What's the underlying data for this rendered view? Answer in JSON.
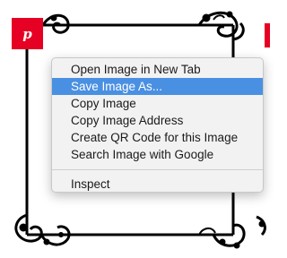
{
  "colors": {
    "pin_red": "#e60023",
    "highlight": "#4a90e2",
    "frame": "#000000",
    "menu_bg": "#f2f2f2"
  },
  "pin_button": {
    "icon": "pinterest-logo-icon",
    "glyph": "p"
  },
  "context_menu": {
    "items": [
      {
        "label": "Open Image in New Tab"
      },
      {
        "label": "Save Image As...",
        "highlighted": true
      },
      {
        "label": "Copy Image"
      },
      {
        "label": "Copy Image Address"
      },
      {
        "label": "Create QR Code for this Image"
      },
      {
        "label": "Search Image with Google"
      }
    ],
    "footer_items": [
      {
        "label": "Inspect"
      }
    ]
  }
}
